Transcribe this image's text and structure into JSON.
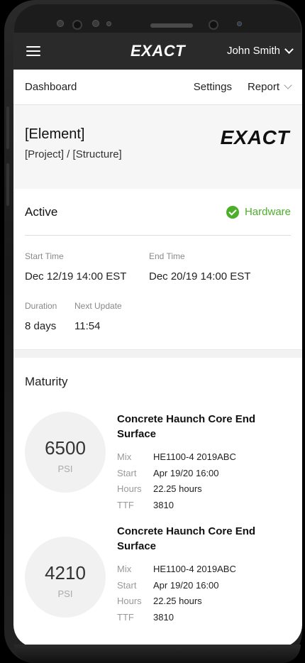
{
  "header": {
    "logo": "EXACT",
    "user_name": "John Smith"
  },
  "subnav": {
    "dashboard": "Dashboard",
    "settings": "Settings",
    "report": "Report"
  },
  "element": {
    "title": "[Element]",
    "path": "[Project] / [Structure]",
    "logo": "EXACT"
  },
  "status": {
    "state": "Active",
    "hardware_label": "Hardware",
    "hardware_color": "#4caf2a",
    "start_time_label": "Start Time",
    "start_time": "Dec 12/19 14:00 EST",
    "end_time_label": "End Time",
    "end_time": "Dec 20/19 14:00 EST",
    "duration_label": "Duration",
    "duration": "8 days",
    "next_update_label": "Next Update",
    "next_update": "11:54"
  },
  "maturity": {
    "title": "Maturity",
    "items": [
      {
        "psi": "6500",
        "unit": "PSI",
        "name": "Concrete Haunch Core End Surface",
        "mix_label": "Mix",
        "mix": "HE1100-4 2019ABC",
        "start_label": "Start",
        "start": "Apr 19/20 16:00",
        "hours_label": "Hours",
        "hours": "22.25 hours",
        "ttf_label": "TTF",
        "ttf": "3810"
      },
      {
        "psi": "4210",
        "unit": "PSI",
        "name": "Concrete Haunch Core End Surface",
        "mix_label": "Mix",
        "mix": "HE1100-4 2019ABC",
        "start_label": "Start",
        "start": "Apr 19/20 16:00",
        "hours_label": "Hours",
        "hours": "22.25 hours",
        "ttf_label": "TTF",
        "ttf": "3810"
      }
    ]
  }
}
